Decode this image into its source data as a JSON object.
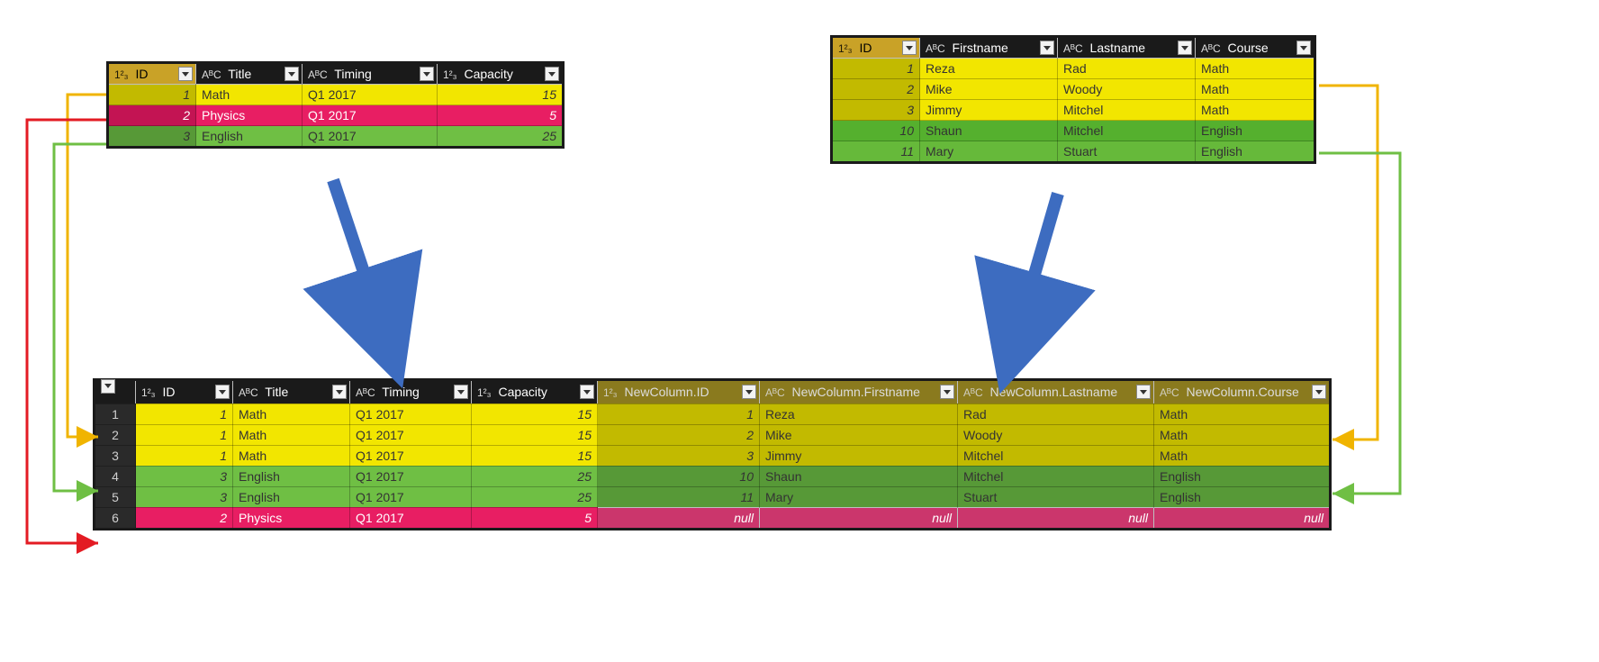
{
  "tables": {
    "courses": {
      "columns": [
        "ID",
        "Title",
        "Timing",
        "Capacity"
      ],
      "types": [
        "num",
        "text",
        "text",
        "num"
      ],
      "rows": [
        {
          "id": 1,
          "title": "Math",
          "timing": "Q1 2017",
          "capacity": 15,
          "color": "yellow"
        },
        {
          "id": 2,
          "title": "Physics",
          "timing": "Q1 2017",
          "capacity": 5,
          "color": "pink"
        },
        {
          "id": 3,
          "title": "English",
          "timing": "Q1 2017",
          "capacity": 25,
          "color": "green"
        }
      ]
    },
    "students": {
      "columns": [
        "ID",
        "Firstname",
        "Lastname",
        "Course"
      ],
      "types": [
        "num",
        "text",
        "text",
        "text"
      ],
      "rows": [
        {
          "id": 1,
          "first": "Reza",
          "last": "Rad",
          "course": "Math",
          "color": "yellow"
        },
        {
          "id": 2,
          "first": "Mike",
          "last": "Woody",
          "course": "Math",
          "color": "yellow"
        },
        {
          "id": 3,
          "first": "Jimmy",
          "last": "Mitchel",
          "course": "Math",
          "color": "yellow"
        },
        {
          "id": 10,
          "first": "Shaun",
          "last": "Mitchel",
          "course": "English",
          "color": "greenb"
        },
        {
          "id": 11,
          "first": "Mary",
          "last": "Stuart",
          "course": "English",
          "color": "greenc"
        }
      ]
    },
    "merged": {
      "columns_left": [
        "ID",
        "Title",
        "Timing",
        "Capacity"
      ],
      "columns_right": [
        "NewColumn.ID",
        "NewColumn.Firstname",
        "NewColumn.Lastname",
        "NewColumn.Course"
      ],
      "types_left": [
        "num",
        "text",
        "text",
        "num"
      ],
      "types_right": [
        "num",
        "text",
        "text",
        "text"
      ],
      "rows": [
        {
          "n": 1,
          "id": 1,
          "title": "Math",
          "timing": "Q1 2017",
          "cap": 15,
          "nid": 1,
          "first": "Reza",
          "last": "Rad",
          "course": "Math",
          "left": "yellow",
          "right": "yellow"
        },
        {
          "n": 2,
          "id": 1,
          "title": "Math",
          "timing": "Q1 2017",
          "cap": 15,
          "nid": 2,
          "first": "Mike",
          "last": "Woody",
          "course": "Math",
          "left": "yellow",
          "right": "yellow"
        },
        {
          "n": 3,
          "id": 1,
          "title": "Math",
          "timing": "Q1 2017",
          "cap": 15,
          "nid": 3,
          "first": "Jimmy",
          "last": "Mitchel",
          "course": "Math",
          "left": "yellow",
          "right": "yellow"
        },
        {
          "n": 4,
          "id": 3,
          "title": "English",
          "timing": "Q1 2017",
          "cap": 25,
          "nid": 10,
          "first": "Shaun",
          "last": "Mitchel",
          "course": "English",
          "left": "green",
          "right": "green"
        },
        {
          "n": 5,
          "id": 3,
          "title": "English",
          "timing": "Q1 2017",
          "cap": 25,
          "nid": 11,
          "first": "Mary",
          "last": "Stuart",
          "course": "English",
          "left": "green",
          "right": "green"
        },
        {
          "n": 6,
          "id": 2,
          "title": "Physics",
          "timing": "Q1 2017",
          "cap": 5,
          "nid": null,
          "first": null,
          "last": null,
          "course": null,
          "left": "pink",
          "right": "pink"
        }
      ]
    }
  },
  "null_text": "null",
  "dtype": {
    "num": "1²₃",
    "text": "AᴮC"
  },
  "connector_colors": {
    "yellow_arrow": "#f0b400",
    "green_arrow": "#6fbf44",
    "red_arrow": "#e31b23",
    "blue_arrow": "#3d6cc0"
  }
}
